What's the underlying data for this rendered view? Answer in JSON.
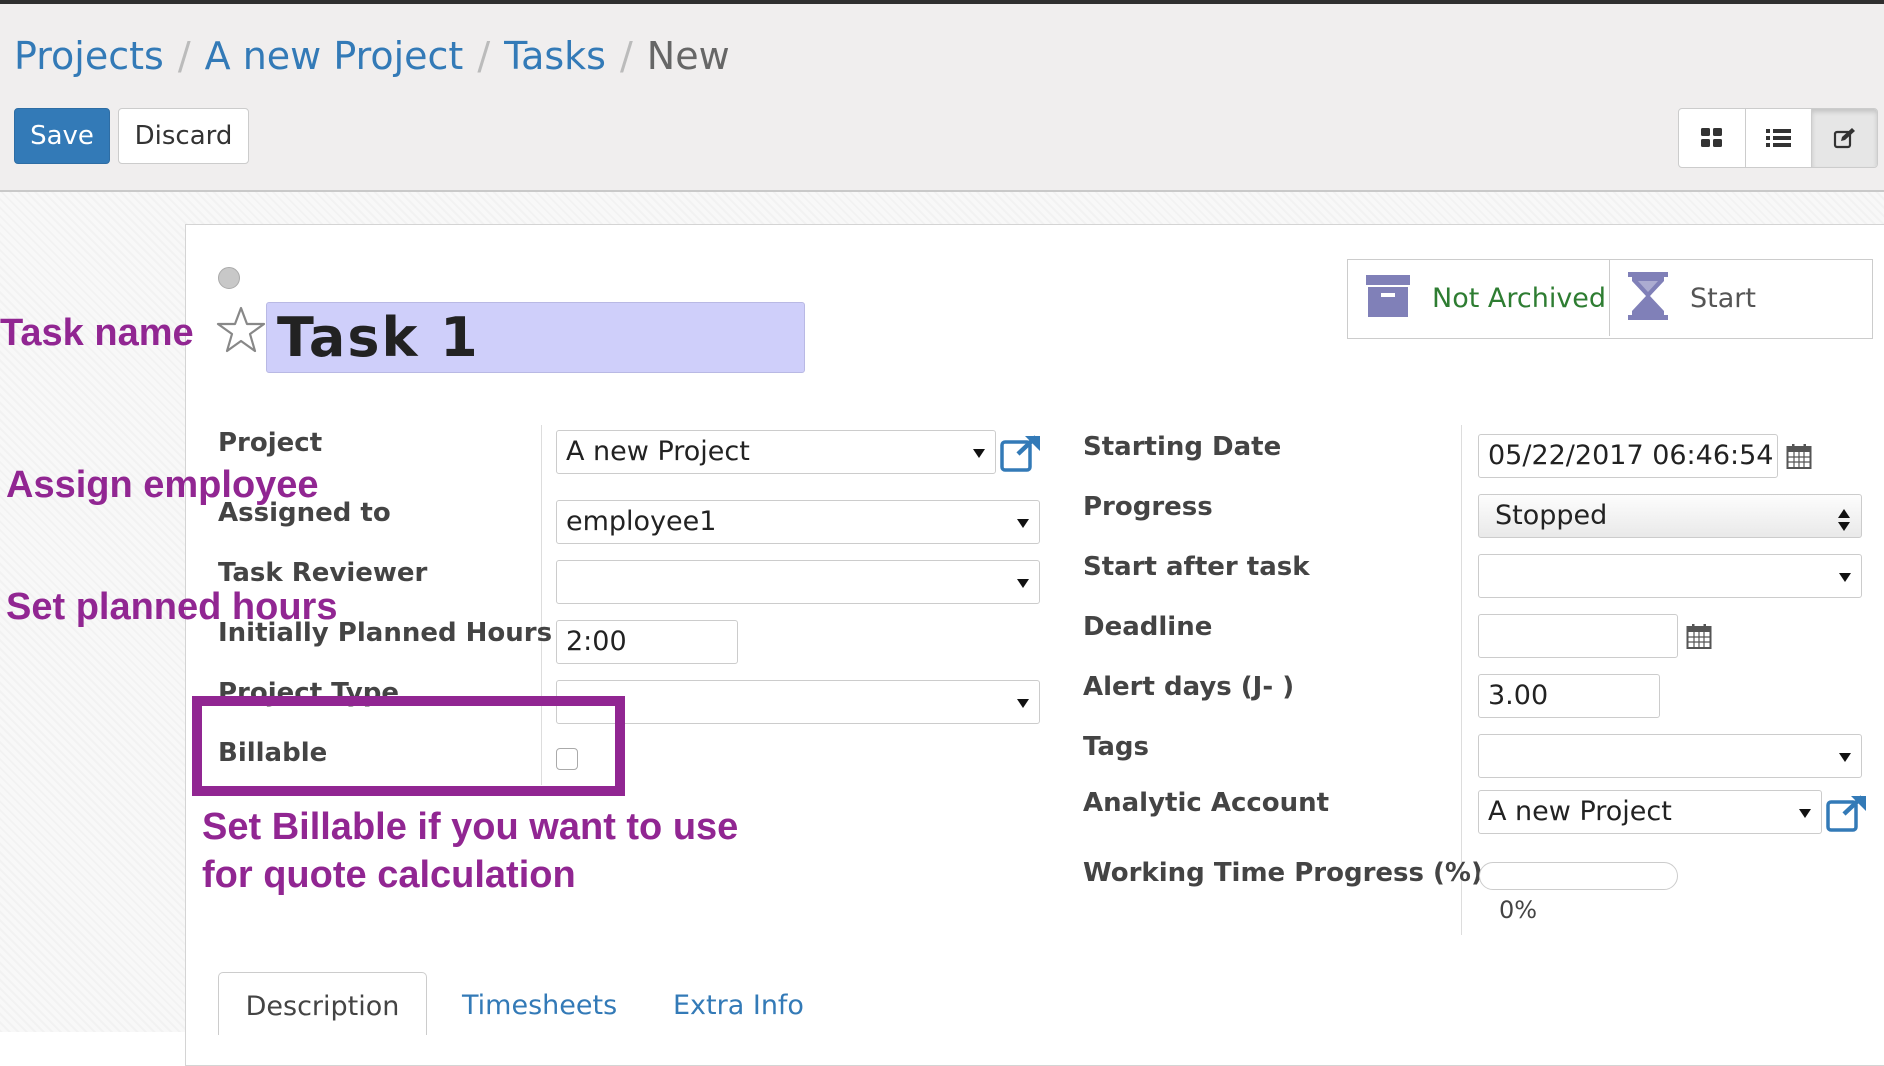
{
  "breadcrumb": {
    "items": [
      "Projects",
      "A new Project",
      "Tasks"
    ],
    "current": "New",
    "separator": "/"
  },
  "buttons": {
    "save": "Save",
    "discard": "Discard"
  },
  "view_switcher": [
    {
      "name": "kanban-view-icon",
      "active": false
    },
    {
      "name": "list-view-icon",
      "active": false
    },
    {
      "name": "form-view-icon",
      "active": true
    }
  ],
  "smart_buttons": {
    "archive": "Not Archived",
    "timer": "Start"
  },
  "task": {
    "name": "Task 1"
  },
  "left_fields": {
    "project": {
      "label": "Project",
      "value": "A new Project"
    },
    "assigned_to": {
      "label": "Assigned to",
      "value": "employee1"
    },
    "task_reviewer": {
      "label": "Task Reviewer",
      "value": ""
    },
    "planned_hours": {
      "label": "Initially Planned Hours",
      "value": "2:00"
    },
    "project_type": {
      "label": "Project Type",
      "value": ""
    },
    "billable": {
      "label": "Billable",
      "checked": false
    }
  },
  "right_fields": {
    "starting_date": {
      "label": "Starting Date",
      "value": "05/22/2017 06:46:54"
    },
    "progress": {
      "label": "Progress",
      "value": "Stopped"
    },
    "start_after_task": {
      "label": "Start after task",
      "value": ""
    },
    "deadline": {
      "label": "Deadline",
      "value": ""
    },
    "alert_days": {
      "label": "Alert days (J- )",
      "value": "3.00"
    },
    "tags": {
      "label": "Tags",
      "value": ""
    },
    "analytic_account": {
      "label": "Analytic Account",
      "value": "A new Project"
    },
    "working_time_progress": {
      "label": "Working Time Progress (%)",
      "value": "0%",
      "fraction": 0
    }
  },
  "tabs": [
    "Description",
    "Timesheets",
    "Extra Info"
  ],
  "annotations": {
    "task_name": "Task name",
    "assign_employee": "Assign employee",
    "planned_hours": "Set planned hours",
    "billable_line1": "Set Billable if you want to use",
    "billable_line2": "for quote calculation"
  },
  "colors": {
    "primary": "#337ab7",
    "annotation": "#912692",
    "title_bg": "#cfcffa",
    "not_archived": "#2e7d32",
    "icon_purple": "#8080b8"
  }
}
